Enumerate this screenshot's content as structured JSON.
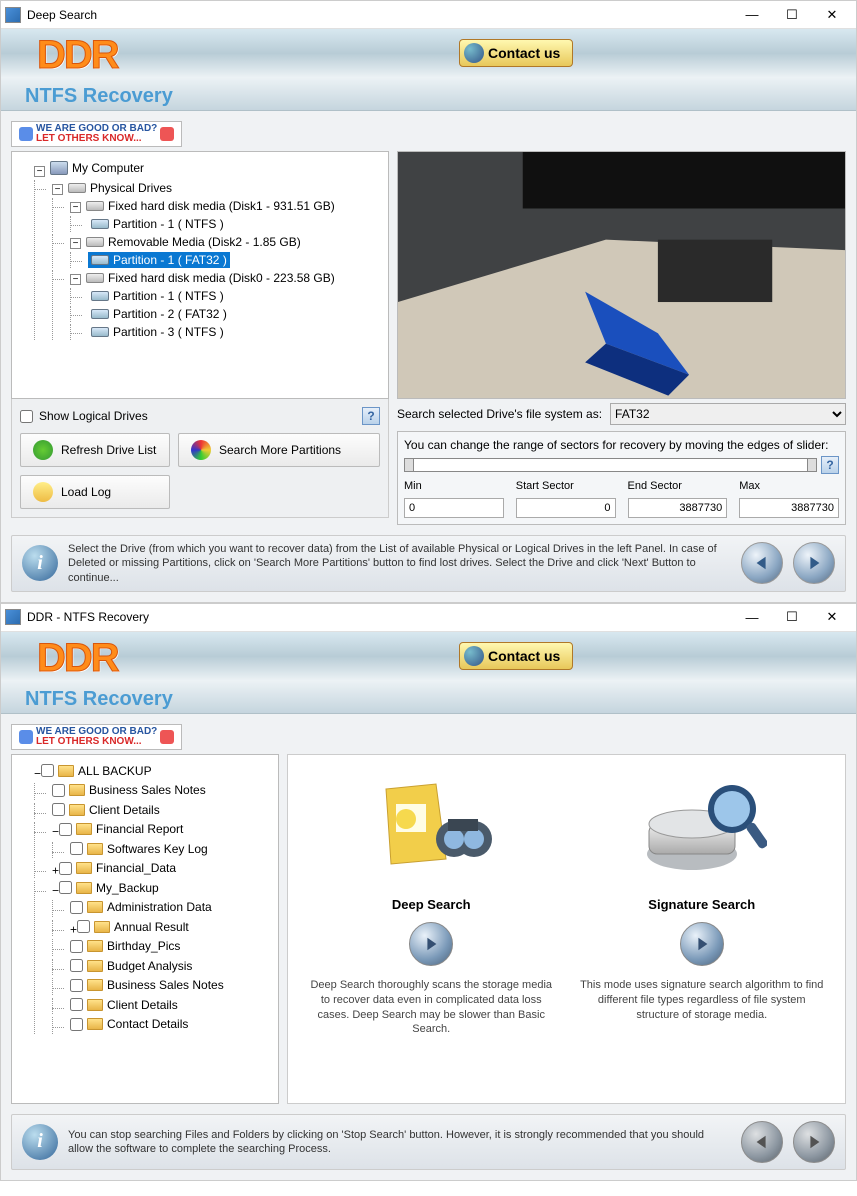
{
  "win1": {
    "title": "Deep Search",
    "banner": {
      "logo": "DDR",
      "subtitle": "NTFS Recovery",
      "contact_label": "Contact us"
    },
    "feedback": {
      "line1": "WE ARE GOOD OR BAD?",
      "line2": "LET OTHERS KNOW..."
    },
    "tree": {
      "root": "My Computer",
      "physical": "Physical Drives",
      "d1": "Fixed hard disk media (Disk1 - 931.51 GB)",
      "d1p1": "Partition - 1 ( NTFS )",
      "d2": "Removable Media (Disk2 - 1.85 GB)",
      "d2p1": "Partition - 1 ( FAT32 )",
      "d0": "Fixed hard disk media (Disk0 - 223.58 GB)",
      "d0p1": "Partition - 1 ( NTFS )",
      "d0p2": "Partition - 2 ( FAT32 )",
      "d0p3": "Partition - 3 ( NTFS )"
    },
    "show_logical": "Show Logical Drives",
    "buttons": {
      "refresh": "Refresh Drive List",
      "search_more": "Search More Partitions",
      "load_log": "Load Log"
    },
    "fs_label": "Search selected Drive's file system as:",
    "fs_value": "FAT32",
    "sector": {
      "hint": "You can change the range of sectors for recovery by moving the edges of slider:",
      "min_l": "Min",
      "start_l": "Start Sector",
      "end_l": "End Sector",
      "max_l": "Max",
      "min": "0",
      "start": "0",
      "end": "3887730",
      "max": "3887730"
    },
    "info": "Select the Drive (from which you want to recover data) from the List of available Physical or Logical Drives in the left Panel. In case of Deleted or missing Partitions, click on 'Search More Partitions' button to find lost drives. Select the Drive and click 'Next' Button to continue..."
  },
  "win2": {
    "title": "DDR - NTFS Recovery",
    "banner": {
      "logo": "DDR",
      "subtitle": "NTFS Recovery",
      "contact_label": "Contact us"
    },
    "feedback": {
      "line1": "WE ARE GOOD OR BAD?",
      "line2": "LET OTHERS KNOW..."
    },
    "folders": {
      "root": "ALL BACKUP",
      "f1": "Business Sales Notes",
      "f2": "Client Details",
      "f3": "Financial Report",
      "f3a": "Softwares Key Log",
      "f4": "Financial_Data",
      "f5": "My_Backup",
      "f5a": "Administration Data",
      "f5b": "Annual Result",
      "f5c": "Birthday_Pics",
      "f5d": "Budget Analysis",
      "f5e": "Business Sales Notes",
      "f5f": "Client Details",
      "f5g": "Contact Details"
    },
    "modes": {
      "deep_title": "Deep Search",
      "deep_desc": "Deep Search thoroughly scans the storage media to recover data even in complicated data loss cases. Deep Search may be slower than Basic Search.",
      "sig_title": "Signature Search",
      "sig_desc": "This mode uses signature search algorithm to find different file types regardless of file system structure of storage media."
    },
    "info": "You can stop searching Files and Folders by clicking on 'Stop Search' button. However, it is strongly recommended that you should allow the software to complete the searching Process."
  }
}
